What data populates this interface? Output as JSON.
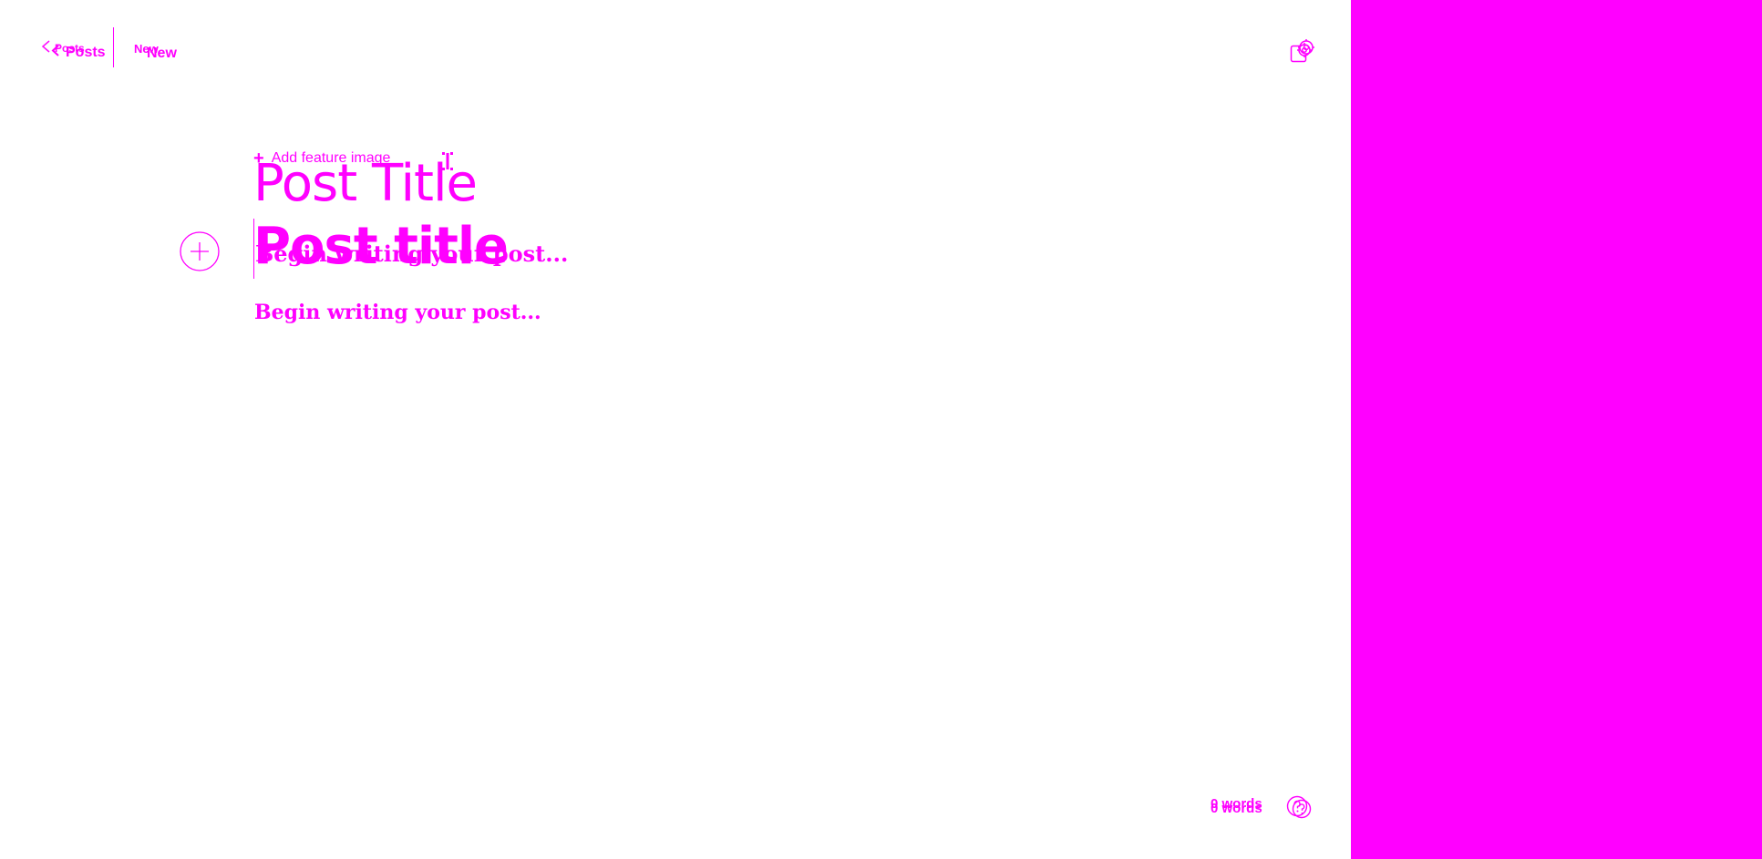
{
  "colors": {
    "accent": "#ff00ff",
    "background": "#ffffff",
    "side_panel": "#ff00ff"
  },
  "header": {
    "back_link_label": "Posts",
    "status_label": "New",
    "back_icon": "chevron-left-icon",
    "settings_icon": "gear-icon"
  },
  "editor": {
    "feature_image_label": "Add feature image",
    "title_text": "Post Title",
    "title_placeholder": "Post title",
    "body_placeholder": "Begin writing your post...",
    "add_block_icon": "plus-circle-icon"
  },
  "footer": {
    "word_count": "0 words",
    "help_icon": "help-circle-icon"
  }
}
